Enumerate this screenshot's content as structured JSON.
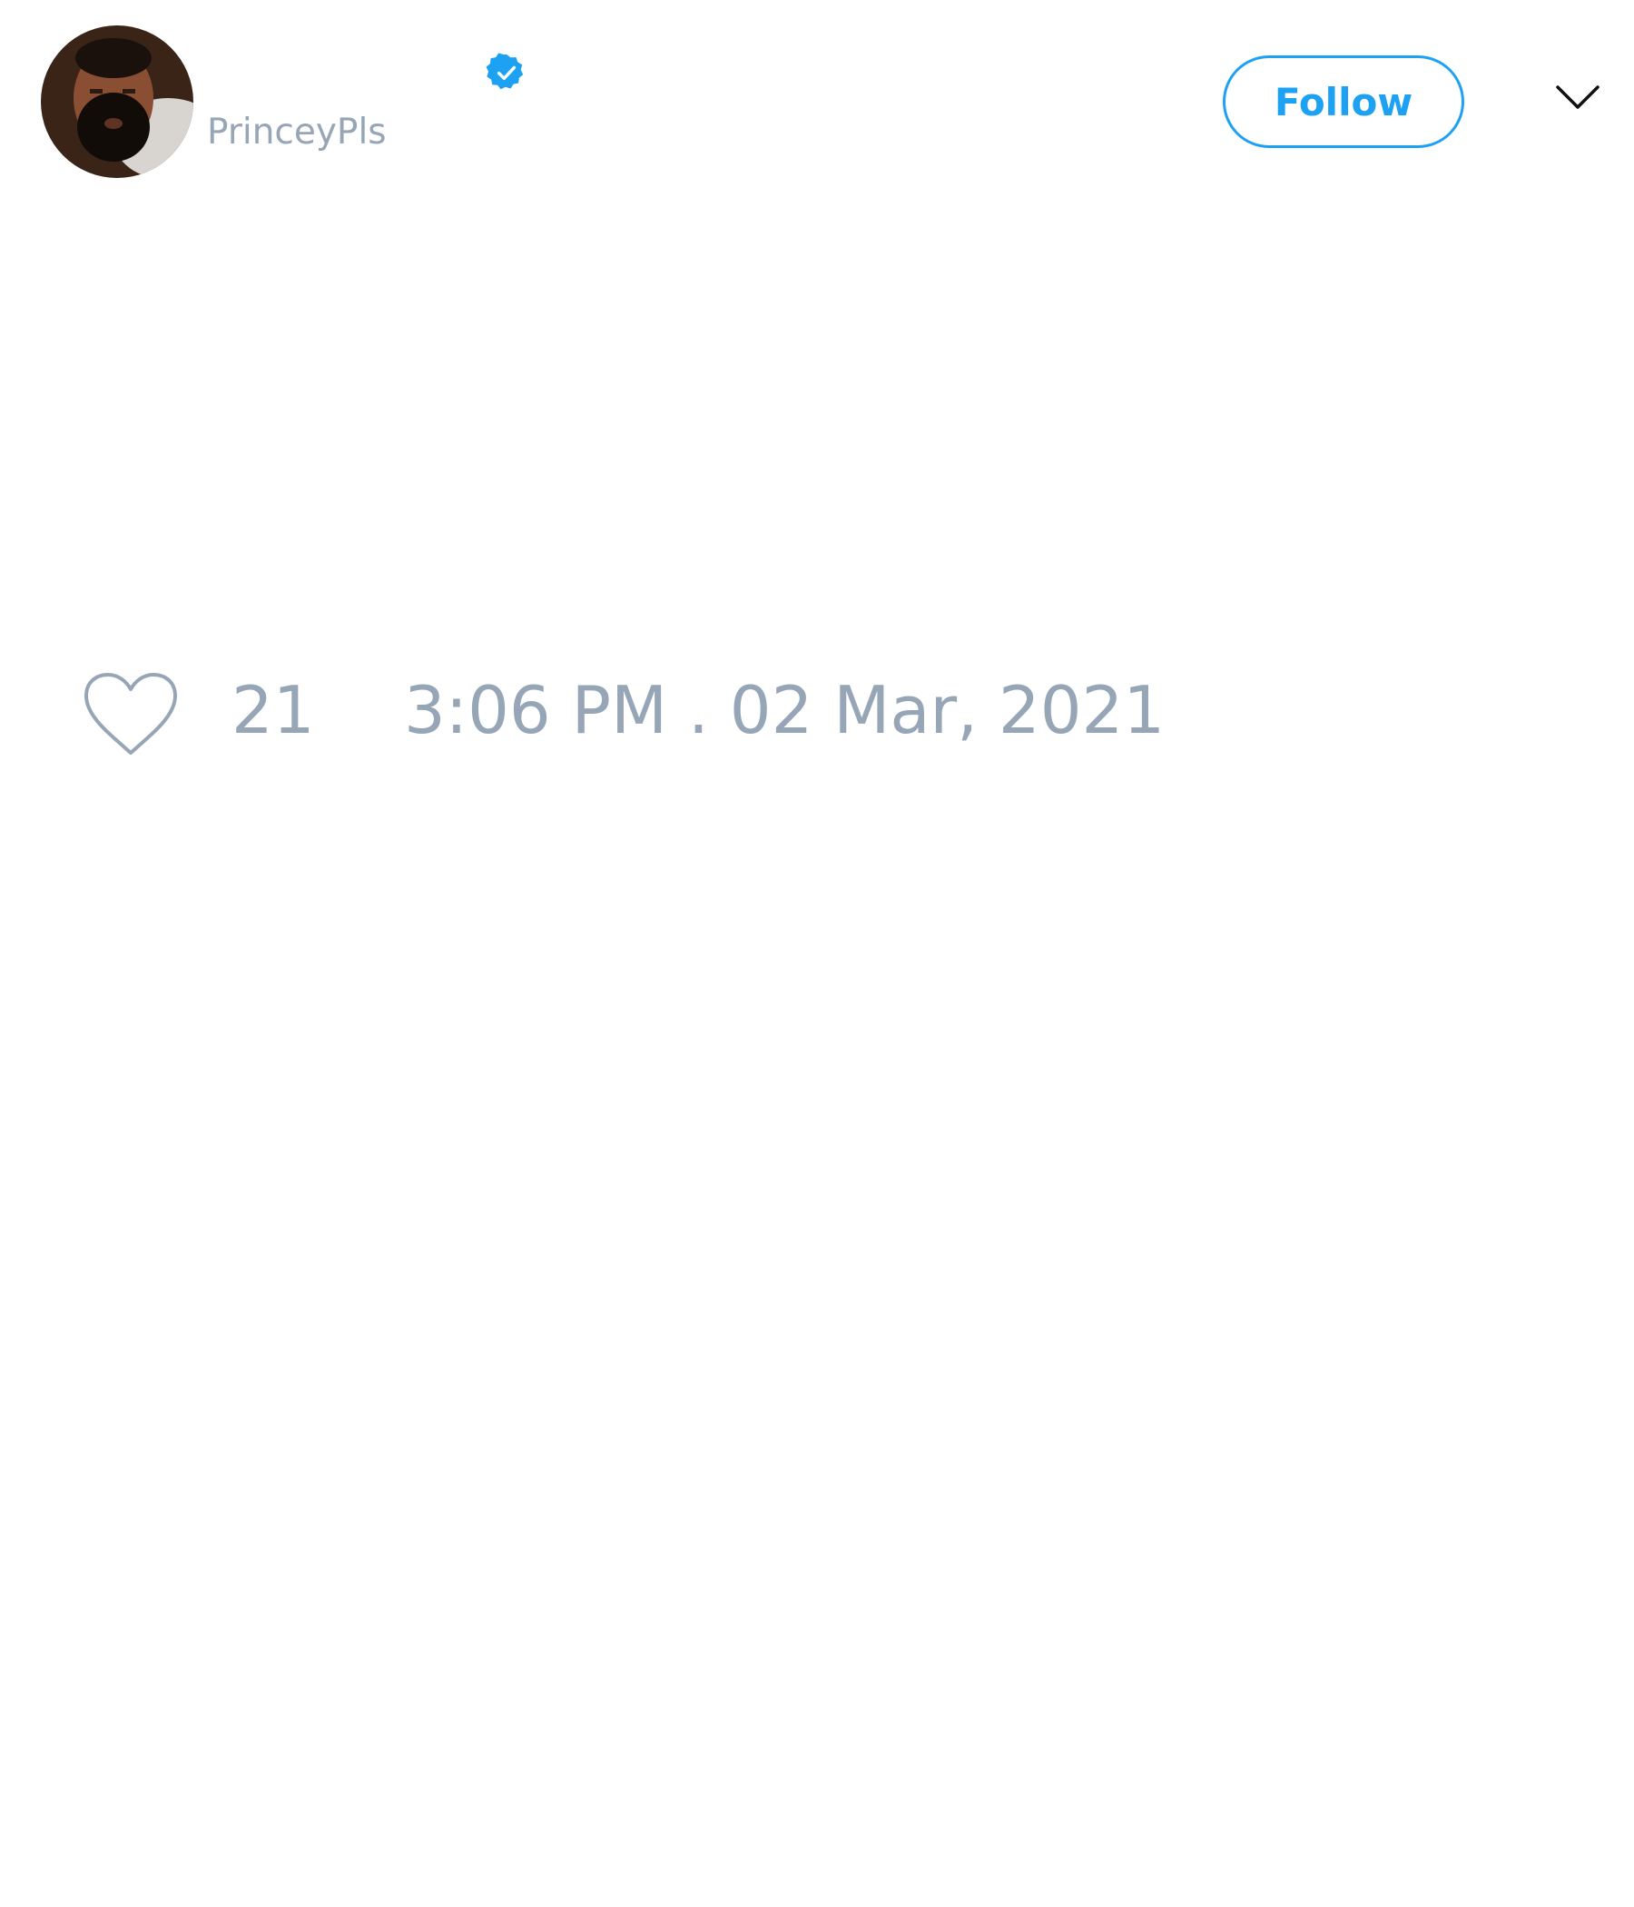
{
  "author": {
    "handle": "PrinceyPls",
    "verified": true
  },
  "header": {
    "follow_label": "Follow"
  },
  "tweet": {
    "like_count": "21",
    "timestamp": "3:06 PM . 02 Mar, 2021"
  },
  "colors": {
    "accent": "#1da1f2",
    "muted_text": "#97a6b7"
  },
  "icons": {
    "verified": "verified-badge-icon",
    "menu": "chevron-down-icon",
    "like": "heart-icon"
  }
}
